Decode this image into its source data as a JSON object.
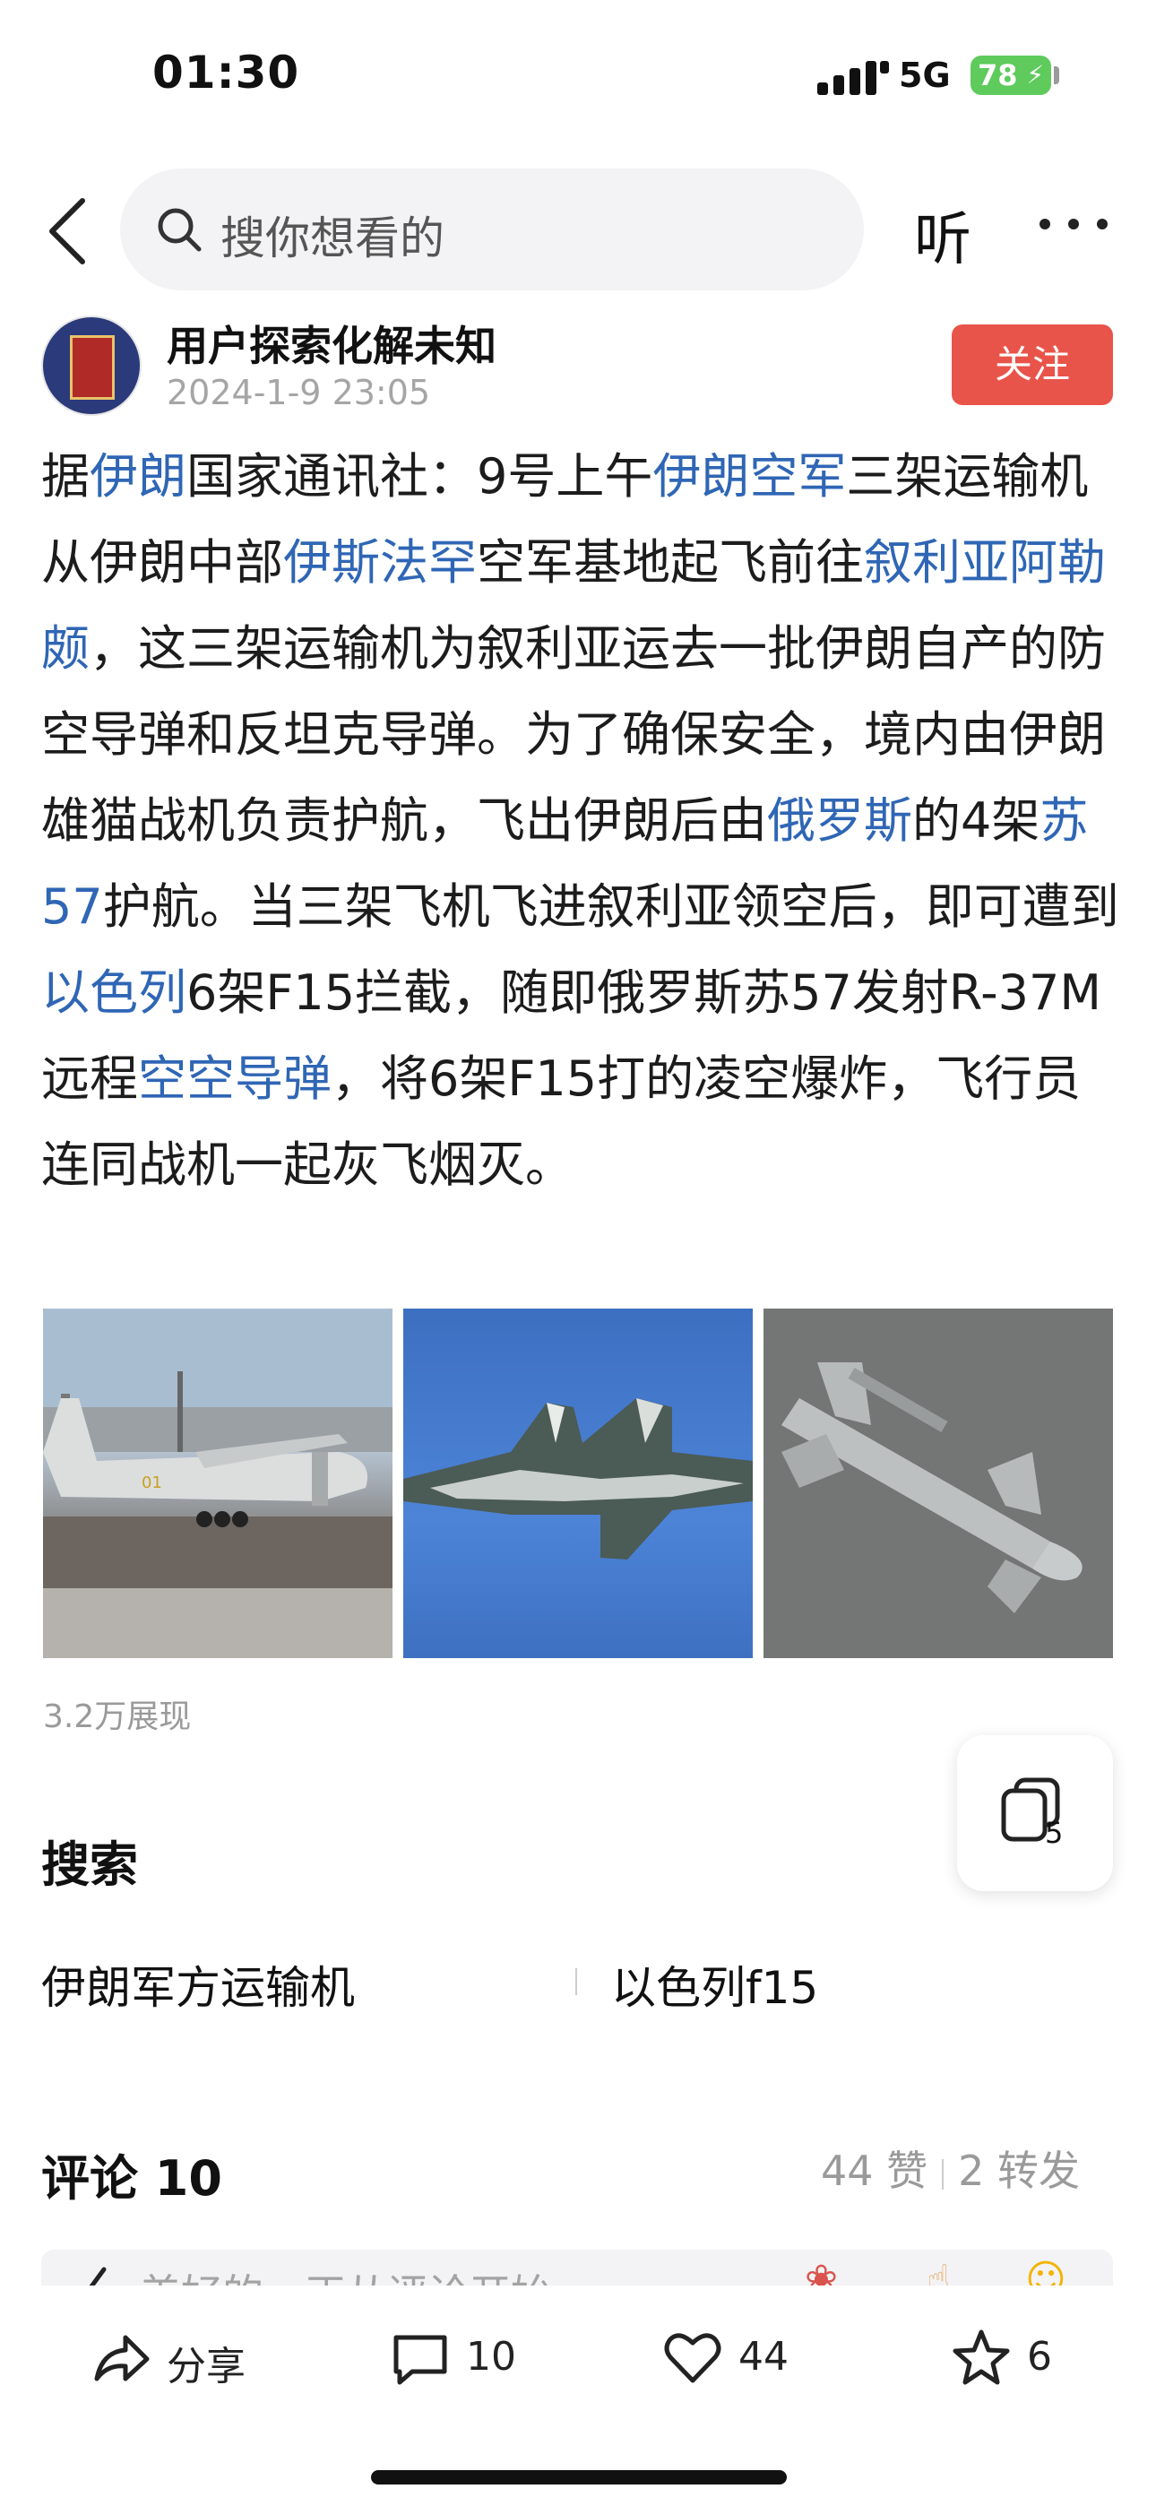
{
  "status_bar": {
    "time": "01:30",
    "network": "5G",
    "battery": "78"
  },
  "nav": {
    "search_placeholder": "搜你想看的",
    "listen_label": "听"
  },
  "author": {
    "name": "用户探索化解未知",
    "date": "2024-1-9 23:05",
    "follow_label": "关注"
  },
  "article": {
    "segments": [
      {
        "text": "据",
        "link": false
      },
      {
        "text": "伊朗",
        "link": true
      },
      {
        "text": "国家通讯社：9号上午",
        "link": false
      },
      {
        "text": "伊朗空军",
        "link": true
      },
      {
        "text": "三架运输机从伊朗中部",
        "link": false
      },
      {
        "text": "伊斯法罕",
        "link": true
      },
      {
        "text": "空军基地起飞前往",
        "link": false
      },
      {
        "text": "叙利亚阿勒颇",
        "link": true
      },
      {
        "text": "，这三架运输机为叙利亚运去一批伊朗自产的防空导弹和反坦克导弹。为了确保安全，境内由伊朗雄猫战机负责护航，飞出伊朗后由",
        "link": false
      },
      {
        "text": "俄罗斯",
        "link": true
      },
      {
        "text": "的4架",
        "link": false
      },
      {
        "text": "苏57",
        "link": true
      },
      {
        "text": "护航。当三架飞机飞进叙利亚领空后，即可遭到",
        "link": false
      },
      {
        "text": "以色列",
        "link": true
      },
      {
        "text": "6架F15拦截，随即俄罗斯苏57发射R-37M远程",
        "link": false
      },
      {
        "text": "空空导弹",
        "link": true
      },
      {
        "text": "，将6架F15打的凌空爆炸，飞行员连同战机一起灰飞烟灭。",
        "link": false
      }
    ]
  },
  "views": "3.2万展现",
  "float_button": {
    "count": "5"
  },
  "search_section": {
    "heading": "搜索",
    "suggestions": [
      "伊朗军方运输机",
      "以色列f15"
    ]
  },
  "comments": {
    "heading": "评论 10",
    "likes": "44 赞",
    "reposts": "2 转发",
    "input_placeholder": "美好的，正从评论开始"
  },
  "bottom_bar": {
    "share": "分享",
    "comments": "10",
    "likes": "44",
    "favorites": "6"
  },
  "colors": {
    "link": "#2f66b5",
    "follow": "#e9544a",
    "battery": "#5ecb5c"
  }
}
